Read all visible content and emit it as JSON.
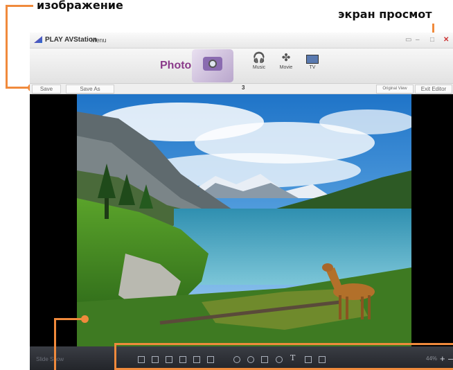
{
  "callouts": {
    "left_top": "изображение",
    "right_top": "экран просмот"
  },
  "app": {
    "name": "PLAY AVStation",
    "menu_label": "Menu",
    "window_buttons": [
      "▭",
      "–",
      "□",
      "✕"
    ]
  },
  "media": {
    "active_label": "Photo",
    "items": [
      {
        "label": "Music",
        "icon": "headphones-icon"
      },
      {
        "label": "Movie",
        "icon": "film-reel-icon"
      },
      {
        "label": "TV",
        "icon": "tv-icon"
      }
    ]
  },
  "toolbar": {
    "save_label": "Save",
    "save_as_label": "Save As",
    "counter": "3",
    "original_view_label": "Original View",
    "exit_editor_label": "Exit Editor"
  },
  "bottombar": {
    "slideshow_label": "Slide Show",
    "tools": [
      "rotate-left-icon",
      "rotate-right-icon",
      "flip-horizontal-icon",
      "flip-vertical-icon",
      "crop-icon",
      "resize-icon",
      "brightness-icon",
      "contrast-icon",
      "saturation-icon",
      "red-eye-icon",
      "text-icon",
      "frame-icon",
      "stamp-icon"
    ],
    "text_tool_glyph": "T",
    "zoom_value": "44%",
    "zoom_plus": "+",
    "zoom_minus": "–"
  },
  "colors": {
    "callout_accent": "#f08a3c",
    "photo_accent": "#8a3a8a"
  }
}
